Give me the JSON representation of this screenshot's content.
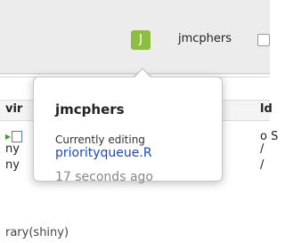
{
  "toolbar": {
    "avatar_letter": "J",
    "avatar_color": "#8cbf3f",
    "username": "jmcphers"
  },
  "background": {
    "left_header_fragment": "vir",
    "right_header_fragment": "ld",
    "left_rows": [
      "ny",
      "ny"
    ],
    "right_rows": [
      "o S",
      "/",
      "/"
    ],
    "bottom_row": "rary(shiny)"
  },
  "popover": {
    "title": "jmcphers",
    "subtitle": "Currently editing",
    "file": "priorityqueue.R",
    "time": "17 seconds ago",
    "link_color": "#1a48c9"
  }
}
